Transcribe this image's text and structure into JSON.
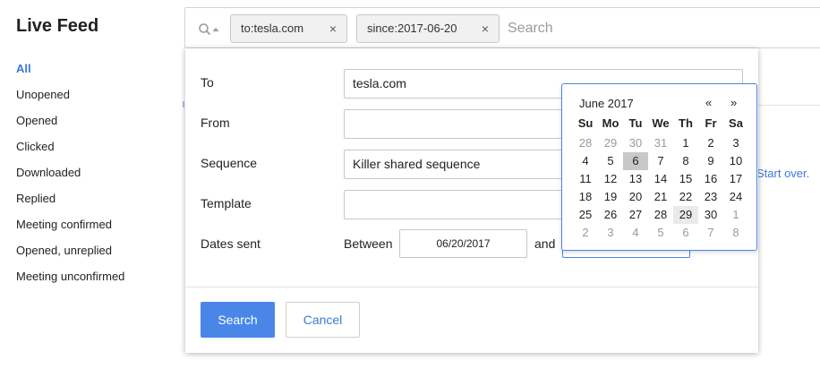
{
  "sidebar": {
    "title": "Live Feed",
    "items": [
      {
        "label": "All",
        "active": true
      },
      {
        "label": "Unopened"
      },
      {
        "label": "Opened"
      },
      {
        "label": "Clicked"
      },
      {
        "label": "Downloaded"
      },
      {
        "label": "Replied"
      },
      {
        "label": "Meeting confirmed"
      },
      {
        "label": "Opened, unreplied"
      },
      {
        "label": "Meeting unconfirmed"
      }
    ]
  },
  "search_bar": {
    "icon": "search-icon",
    "tokens": [
      {
        "label": "to:tesla.com",
        "remove": "×"
      },
      {
        "label": "since:2017-06-20",
        "remove": "×"
      }
    ],
    "placeholder": "Search"
  },
  "background": {
    "start_over_link": "Start over."
  },
  "filter_panel": {
    "fields": {
      "to": {
        "label": "To",
        "value": "tesla.com"
      },
      "from": {
        "label": "From",
        "value": ""
      },
      "sequence": {
        "label": "Sequence",
        "value": "Killer shared sequence"
      },
      "template": {
        "label": "Template",
        "value": ""
      }
    },
    "dates_sent": {
      "label": "Dates sent",
      "between_label": "Between",
      "start": "06/20/2017",
      "and_label": "and",
      "end": ""
    },
    "buttons": {
      "search": "Search",
      "cancel": "Cancel"
    }
  },
  "calendar": {
    "month_label": "June 2017",
    "prev": "«",
    "next": "»",
    "weekdays": [
      "Su",
      "Mo",
      "Tu",
      "We",
      "Th",
      "Fr",
      "Sa"
    ],
    "weeks": [
      [
        "28",
        "29",
        "30",
        "31",
        "1",
        "2",
        "3"
      ],
      [
        "4",
        "5",
        "6",
        "7",
        "8",
        "9",
        "10"
      ],
      [
        "11",
        "12",
        "13",
        "14",
        "15",
        "16",
        "17"
      ],
      [
        "18",
        "19",
        "20",
        "21",
        "22",
        "23",
        "24"
      ],
      [
        "25",
        "26",
        "27",
        "28",
        "29",
        "30",
        "1"
      ],
      [
        "2",
        "3",
        "4",
        "5",
        "6",
        "7",
        "8"
      ]
    ],
    "selected_day": "6",
    "highlighted_day": "29"
  },
  "colors": {
    "accent": "#4a86e8",
    "link": "#3c78d8",
    "selected_day_bg": "#c8c8c8"
  }
}
